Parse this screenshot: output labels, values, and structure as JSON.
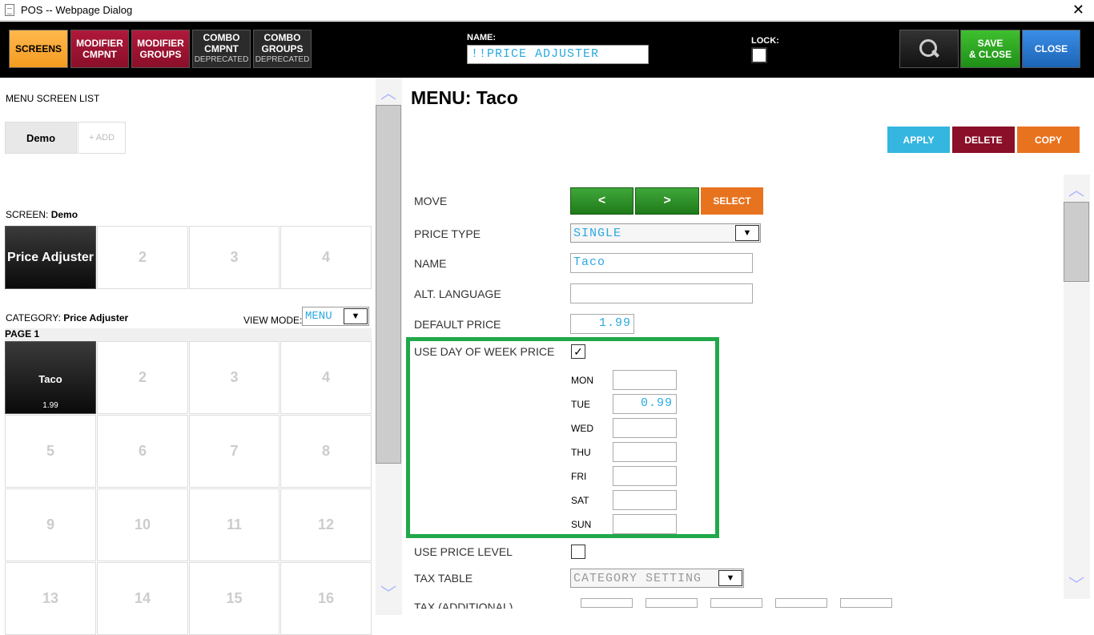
{
  "window": {
    "title": "POS -- Webpage Dialog",
    "close_glyph": "✕"
  },
  "toolbar": {
    "screens": "SCREENS",
    "modifier_cmpnt": [
      "MODIFIER",
      "CMPNT"
    ],
    "modifier_groups": [
      "MODIFIER",
      "GROUPS"
    ],
    "combo_cmpnt": [
      "COMBO",
      "CMPNT",
      "DEPRECATED"
    ],
    "combo_groups": [
      "COMBO",
      "GROUPS",
      "DEPRECATED"
    ],
    "name_label": "NAME:",
    "name_value": "!!PRICE ADJUSTER",
    "lock_label": "LOCK:",
    "save_close": [
      "SAVE",
      "& CLOSE"
    ],
    "close": "CLOSE"
  },
  "left": {
    "menu_screen_list": "MENU SCREEN LIST",
    "tab_demo": "Demo",
    "tab_add": "+ ADD",
    "screen_label": "SCREEN:",
    "screen_name": "Demo",
    "screen_cells": [
      "Price Adjuster",
      "2",
      "3",
      "4"
    ],
    "category_label": "CATEGORY:",
    "category_name": "Price Adjuster",
    "view_mode_label": "VIEW MODE:",
    "view_mode_value": "MENU",
    "page_label": "PAGE 1",
    "items": [
      {
        "label": "Taco",
        "price": "1.99"
      },
      {
        "label": "2"
      },
      {
        "label": "3"
      },
      {
        "label": "4"
      },
      {
        "label": "5"
      },
      {
        "label": "6"
      },
      {
        "label": "7"
      },
      {
        "label": "8"
      },
      {
        "label": "9"
      },
      {
        "label": "10"
      },
      {
        "label": "11"
      },
      {
        "label": "12"
      },
      {
        "label": "13"
      },
      {
        "label": "14"
      },
      {
        "label": "15"
      },
      {
        "label": "16"
      }
    ]
  },
  "right": {
    "menu_title": "MENU: Taco",
    "apply": "APPLY",
    "delete": "DELETE",
    "copy": "COPY",
    "move_label": "MOVE",
    "move_left": "<",
    "move_right": ">",
    "select": "SELECT",
    "price_type_label": "PRICE TYPE",
    "price_type_value": "SINGLE",
    "name_label": "NAME",
    "name_value": "Taco",
    "alt_language_label": "ALT. LANGUAGE",
    "alt_language_value": "",
    "default_price_label": "DEFAULT PRICE",
    "default_price_value": "1.99",
    "use_dow_label": "USE DAY OF WEEK PRICE",
    "use_dow_checked": "✓",
    "days": [
      {
        "label": "MON",
        "value": ""
      },
      {
        "label": "TUE",
        "value": "0.99"
      },
      {
        "label": "WED",
        "value": ""
      },
      {
        "label": "THU",
        "value": ""
      },
      {
        "label": "FRI",
        "value": ""
      },
      {
        "label": "SAT",
        "value": ""
      },
      {
        "label": "SUN",
        "value": ""
      }
    ],
    "use_price_level_label": "USE PRICE LEVEL",
    "tax_table_label": "TAX TABLE",
    "tax_table_value": "CATEGORY SETTING",
    "tax_additional_label": "TAX (ADDITIONAL)"
  },
  "colors": {
    "accent_text": "#29a9e0",
    "highlight_box": "#20a84a"
  },
  "icons": {
    "scroll_up": "chevron-up-icon",
    "scroll_down": "chevron-down-icon",
    "search": "search-icon"
  }
}
